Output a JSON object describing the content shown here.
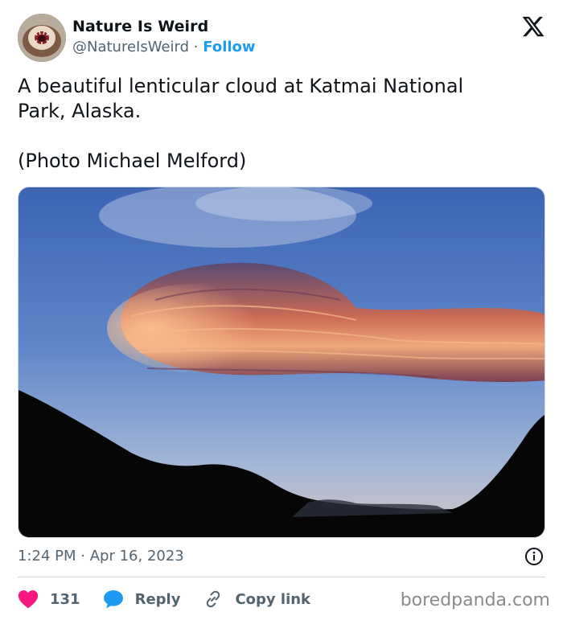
{
  "author": {
    "name": "Nature Is Weird",
    "handle": "@NatureIsWeird",
    "separator": "·",
    "follow_label": "Follow",
    "avatar_icon": "avatar-image"
  },
  "brand": {
    "logo_icon": "x-logo-icon"
  },
  "tweet": {
    "line1": "A beautiful lenticular cloud at Katmai National",
    "line2": "Park, Alaska.",
    "line3": "(Photo Michael Melford)"
  },
  "media": {
    "description_icon": "photo-image"
  },
  "meta": {
    "time": "1:24 PM",
    "separator": "·",
    "date": "Apr 16, 2023",
    "info_icon": "info-icon"
  },
  "actions": {
    "like_count": "131",
    "reply_label": "Reply",
    "copy_link_label": "Copy link"
  },
  "colors": {
    "accent": "#1d9bf0",
    "like": "#f91880",
    "text": "#0f1419",
    "muted": "#536471"
  },
  "watermark": {
    "text": "boredpanda.com"
  }
}
